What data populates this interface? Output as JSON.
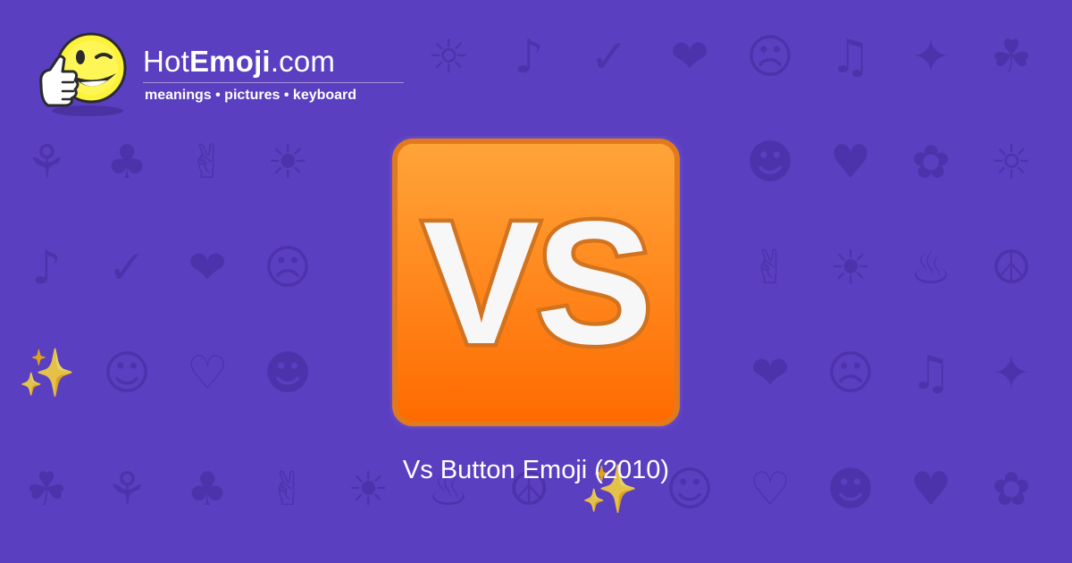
{
  "brand": {
    "name_prefix": "Hot",
    "name_bold": "Emoji",
    "name_suffix": ".com",
    "tagline": "meanings • pictures • keyboard"
  },
  "hero": {
    "emoji_text": "VS",
    "icon": "vs-button-emoji"
  },
  "caption": "Vs Button Emoji (2010)",
  "colors": {
    "background": "#5a3fc0",
    "pattern": "#4b31a8",
    "button_top": "#ffa53a",
    "button_bottom": "#ff6a00",
    "button_border": "#e07a1c"
  },
  "background_icons": [
    "relieved-face",
    "broken-heart",
    "heart",
    "smiling-face",
    "squinting-face",
    "winking-face",
    "two-hearts",
    "grinning-face",
    "cowboy-face",
    "ok-hand",
    "expressionless-face",
    "eyes",
    "smirking-face",
    "recycling-symbol",
    "raising-hands",
    "musical-notes",
    "sparkles",
    "grinning-squinting-face",
    "confused-face",
    "cat-face",
    "see-no-evil-monkey",
    "left-arrow",
    "fire",
    "rose",
    "sun",
    "flexed-biceps",
    "check-mark",
    "camera",
    "face-blowing-kiss"
  ]
}
